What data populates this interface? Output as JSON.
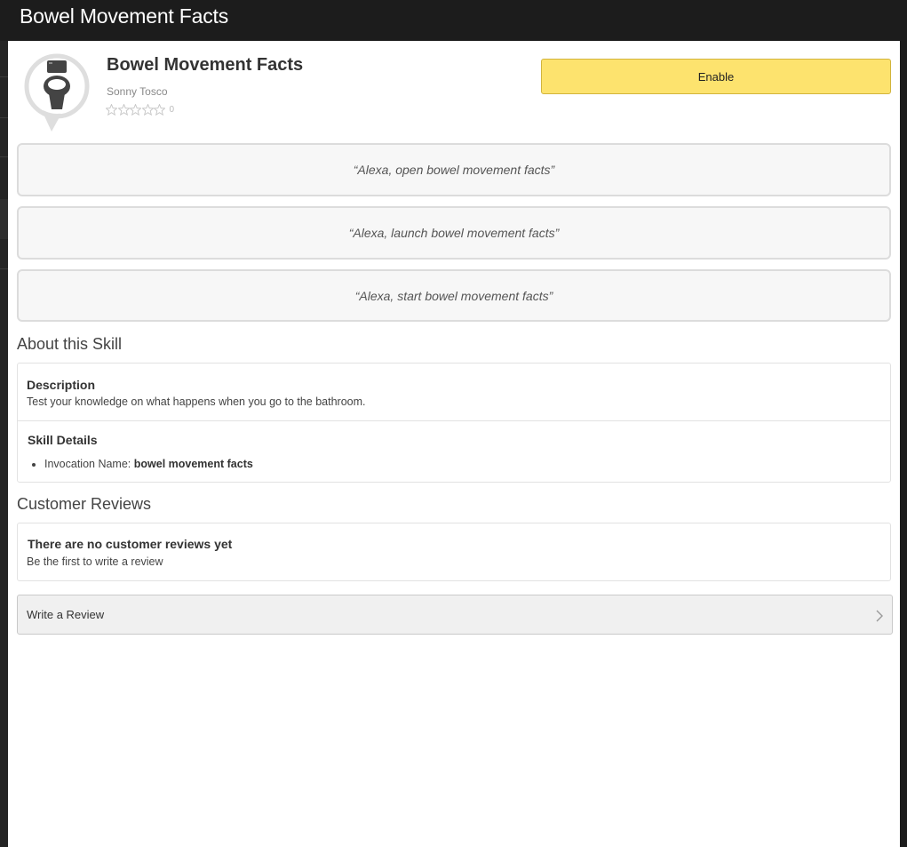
{
  "window": {
    "title": "Bowel Movement Facts"
  },
  "skill": {
    "name": "Bowel Movement Facts",
    "author": "Sonny Tosco",
    "rating_stars": 0,
    "rating_count": "0",
    "icon": "toilet-icon",
    "enable_label": "Enable"
  },
  "utterances": [
    "“Alexa, open bowel movement facts”",
    "“Alexa, launch bowel movement facts”",
    "“Alexa, start bowel movement facts”"
  ],
  "about": {
    "title": "About this Skill",
    "description_label": "Description",
    "description_text": "Test your knowledge on what happens when you go to the bathroom.",
    "details_label": "Skill Details",
    "invocation_label": "Invocation Name: ",
    "invocation_value": "bowel movement facts"
  },
  "reviews": {
    "title": "Customer Reviews",
    "empty_title": "There are no customer reviews yet",
    "empty_text": "Be the first to write a review",
    "write_label": "Write a Review"
  },
  "colors": {
    "enable_button": "#fde36e",
    "titlebar": "#1c1c1c"
  }
}
